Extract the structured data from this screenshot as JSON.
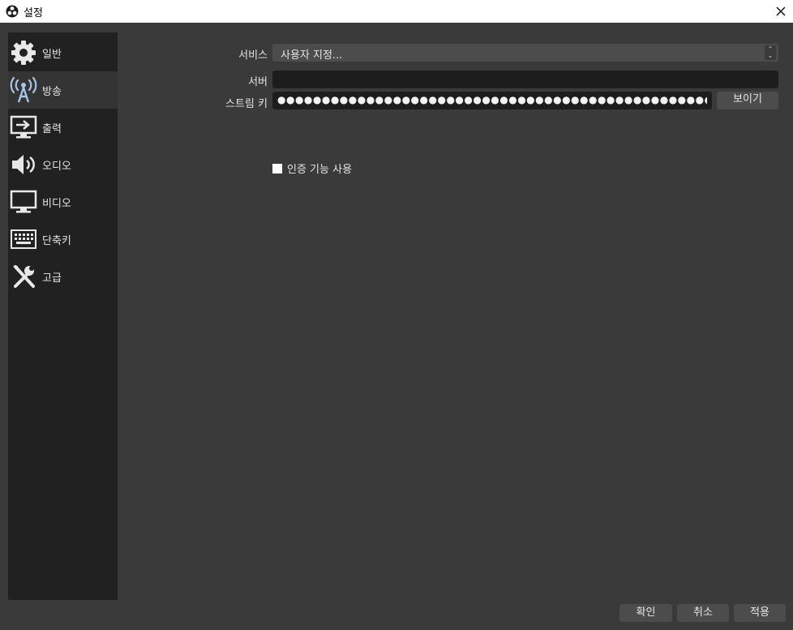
{
  "window": {
    "title": "설정",
    "app_icon": "obs-logo-icon",
    "close_icon": "close-icon"
  },
  "sidebar": {
    "items": [
      {
        "label": "일반",
        "icon": "gear-icon",
        "selected": false
      },
      {
        "label": "방송",
        "icon": "broadcast-antenna-icon",
        "selected": true
      },
      {
        "label": "출력",
        "icon": "output-monitor-icon",
        "selected": false
      },
      {
        "label": "오디오",
        "icon": "speaker-icon",
        "selected": false
      },
      {
        "label": "비디오",
        "icon": "monitor-icon",
        "selected": false
      },
      {
        "label": "단축키",
        "icon": "keyboard-icon",
        "selected": false
      },
      {
        "label": "고급",
        "icon": "tools-icon",
        "selected": false
      }
    ]
  },
  "stream": {
    "service_label": "서비스",
    "service_value": "사용자 지정...",
    "server_label": "서버",
    "server_value": "",
    "key_label": "스트림 키",
    "key_masked": "●●●●●●●●●●●●●●●●●●●●●●●●●●●●●●●●●●●●●●●●●●●●●●●●●●●●●●●●●●●●●●",
    "show_button": "보이기",
    "auth_checkbox_label": "인증 기능 사용",
    "auth_checked": false
  },
  "footer": {
    "ok": "확인",
    "cancel": "취소",
    "apply": "적용"
  },
  "colors": {
    "window_bg": "#3a3a3a",
    "sidebar_bg": "#212121",
    "selected_bg": "#343434",
    "field_bg": "#1d1d1d",
    "button_bg": "#4c4c4c",
    "accent_icon": "#a8c4e8"
  }
}
